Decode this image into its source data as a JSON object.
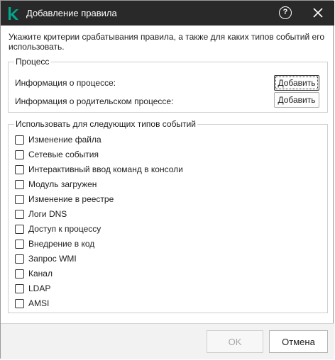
{
  "window": {
    "title": "Добавление правила",
    "logo_icon": "kaspersky-k-logo",
    "help_icon": "question-circle-icon",
    "help_glyph": "?",
    "close_icon": "close-icon",
    "accent_color": "#00a88e",
    "titlebar_color": "#292929"
  },
  "description": "Укажите критерии срабатывания правила, а также для каких типов событий его использовать.",
  "process_group": {
    "legend": "Процесс",
    "rows": [
      {
        "label": "Информация о процессе:",
        "button": "Добавить"
      },
      {
        "label": "Информация о родительском процессе:",
        "button": "Добавить"
      }
    ]
  },
  "events_group": {
    "legend": "Использовать для следующих типов событий",
    "items": [
      {
        "label": "Изменение файла",
        "checked": false
      },
      {
        "label": "Сетевые события",
        "checked": false
      },
      {
        "label": "Интерактивный ввод команд в консоли",
        "checked": false
      },
      {
        "label": "Модуль загружен",
        "checked": false
      },
      {
        "label": "Изменение в реестре",
        "checked": false
      },
      {
        "label": "Логи DNS",
        "checked": false
      },
      {
        "label": "Доступ к процессу",
        "checked": false
      },
      {
        "label": "Внедрение в код",
        "checked": false
      },
      {
        "label": "Запрос WMI",
        "checked": false
      },
      {
        "label": "Канал",
        "checked": false
      },
      {
        "label": "LDAP",
        "checked": false
      },
      {
        "label": "AMSI",
        "checked": false
      }
    ]
  },
  "footer": {
    "ok_label": "OK",
    "cancel_label": "Отмена"
  }
}
